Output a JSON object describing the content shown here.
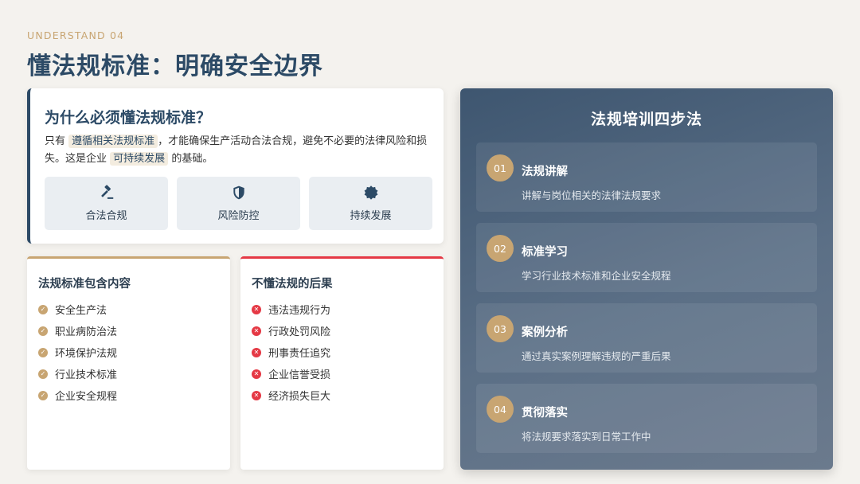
{
  "header": {
    "eyebrow": "UNDERSTAND 04",
    "title": "懂法规标准：明确安全边界"
  },
  "why": {
    "title": "为什么必须懂法规标准？",
    "text_1": "只有",
    "highlight_1": "遵循相关法规标准",
    "text_2": "，才能确保生产活动合法合规，避免不必要的法律风险和损失。这是企业",
    "highlight_2": "可持续发展",
    "text_3": "的基础。",
    "chips": [
      {
        "icon": "gavel-icon",
        "label": "合法合规"
      },
      {
        "icon": "shield-icon",
        "label": "风险防控"
      },
      {
        "icon": "badge-icon",
        "label": "持续发展"
      }
    ]
  },
  "content_card": {
    "title": "法规标准包含内容",
    "items": [
      "安全生产法",
      "职业病防治法",
      "环境保护法规",
      "行业技术标准",
      "企业安全规程"
    ]
  },
  "consequence_card": {
    "title": "不懂法规的后果",
    "items": [
      "违法违规行为",
      "行政处罚风险",
      "刑事责任追究",
      "企业信誉受损",
      "经济损失巨大"
    ]
  },
  "steps": {
    "title": "法规培训四步法",
    "items": [
      {
        "num": "01",
        "title": "法规讲解",
        "desc": "讲解与岗位相关的法律法规要求"
      },
      {
        "num": "02",
        "title": "标准学习",
        "desc": "学习行业技术标准和企业安全规程"
      },
      {
        "num": "03",
        "title": "案例分析",
        "desc": "通过真实案例理解违规的严重后果"
      },
      {
        "num": "04",
        "title": "贯彻落实",
        "desc": "将法规要求落实到日常工作中"
      }
    ]
  },
  "colors": {
    "navy": "#2c4a66",
    "gold": "#c8a572",
    "red": "#e53945"
  }
}
